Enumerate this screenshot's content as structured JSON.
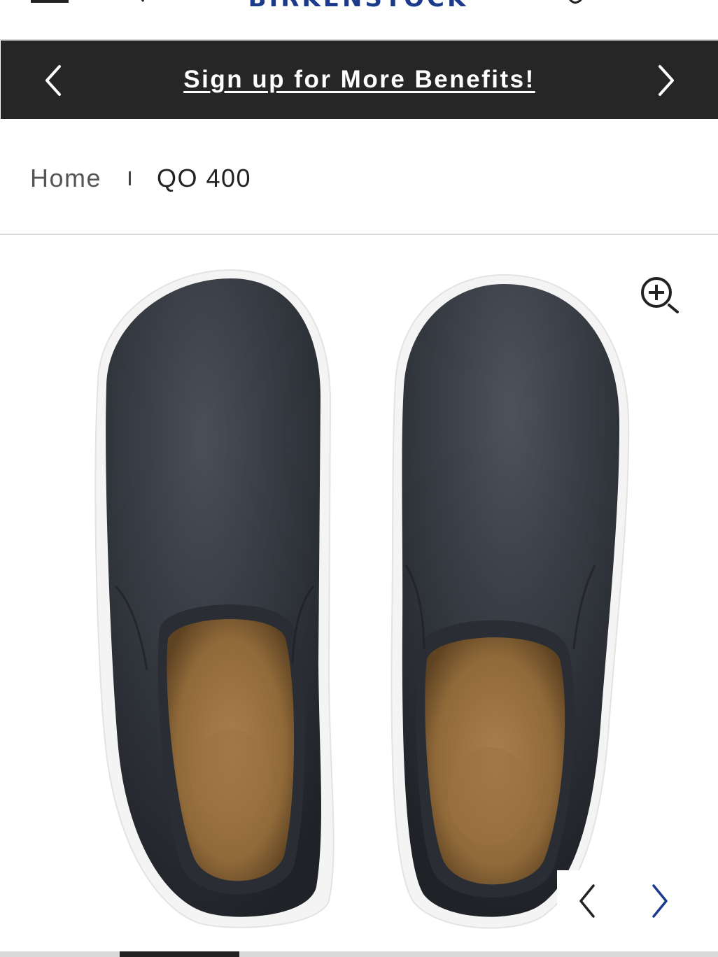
{
  "header": {
    "logo_text": "BIRKENSTOCK",
    "menu_icon": "hamburger-menu-icon",
    "search_icon": "search-icon",
    "account_icon": "account-icon",
    "cart_icon": "cart-icon",
    "brand_color": "#1c3a8c"
  },
  "promo": {
    "text": "Sign up for More Benefits!",
    "prev_icon": "chevron-left-icon",
    "next_icon": "chevron-right-icon",
    "background": "#262626"
  },
  "breadcrumb": {
    "home": "Home",
    "current": "QO 400"
  },
  "gallery": {
    "image_alt": "Black leather slip-on shoes, top view",
    "zoom_icon": "zoom-in-icon",
    "prev_icon": "chevron-left-icon",
    "next_icon": "chevron-right-icon",
    "active_slide": 2,
    "total_slides": 6,
    "accent_color": "#1c3a8c"
  }
}
